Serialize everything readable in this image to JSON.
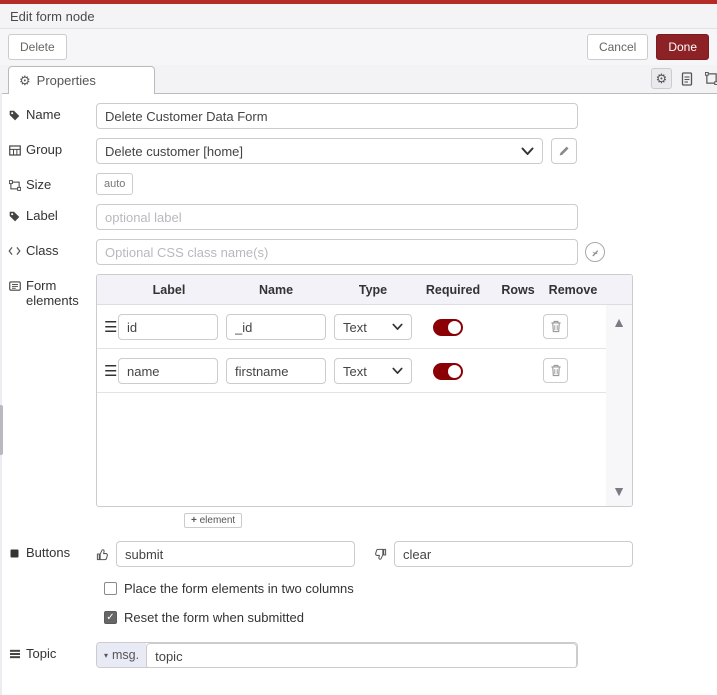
{
  "dialog": {
    "title": "Edit form node",
    "delete_label": "Delete",
    "cancel_label": "Cancel",
    "done_label": "Done"
  },
  "tabs": {
    "properties_label": "Properties"
  },
  "fields": {
    "name": {
      "label": "Name",
      "value": "Delete Customer Data Form"
    },
    "group": {
      "label": "Group",
      "value": "Delete customer [home]"
    },
    "size": {
      "label": "Size",
      "value": "auto"
    },
    "label": {
      "label": "Label",
      "placeholder": "optional label"
    },
    "class": {
      "label": "Class",
      "placeholder": "Optional CSS class name(s)"
    },
    "topic": {
      "label": "Topic",
      "prefix": "msg.",
      "value": "topic"
    }
  },
  "form_elements": {
    "label_line1": "Form",
    "label_line2": "elements",
    "columns": [
      "Label",
      "Name",
      "Type",
      "Required",
      "Rows",
      "Remove"
    ],
    "rows": [
      {
        "label": "id",
        "name": "_id",
        "type": "Text",
        "required": true
      },
      {
        "label": "name",
        "name": "firstname",
        "type": "Text",
        "required": true
      }
    ],
    "add_label": "element"
  },
  "buttons_field": {
    "label": "Buttons",
    "submit_value": "submit",
    "clear_value": "clear"
  },
  "checkboxes": [
    {
      "label": "Place the form elements in two columns",
      "checked": false
    },
    {
      "label": "Reset the form when submitted",
      "checked": true
    }
  ],
  "colors": {
    "accent_red_top": "#b52b27",
    "done_red": "#8c2126",
    "toggle_red": "#8b0004"
  }
}
